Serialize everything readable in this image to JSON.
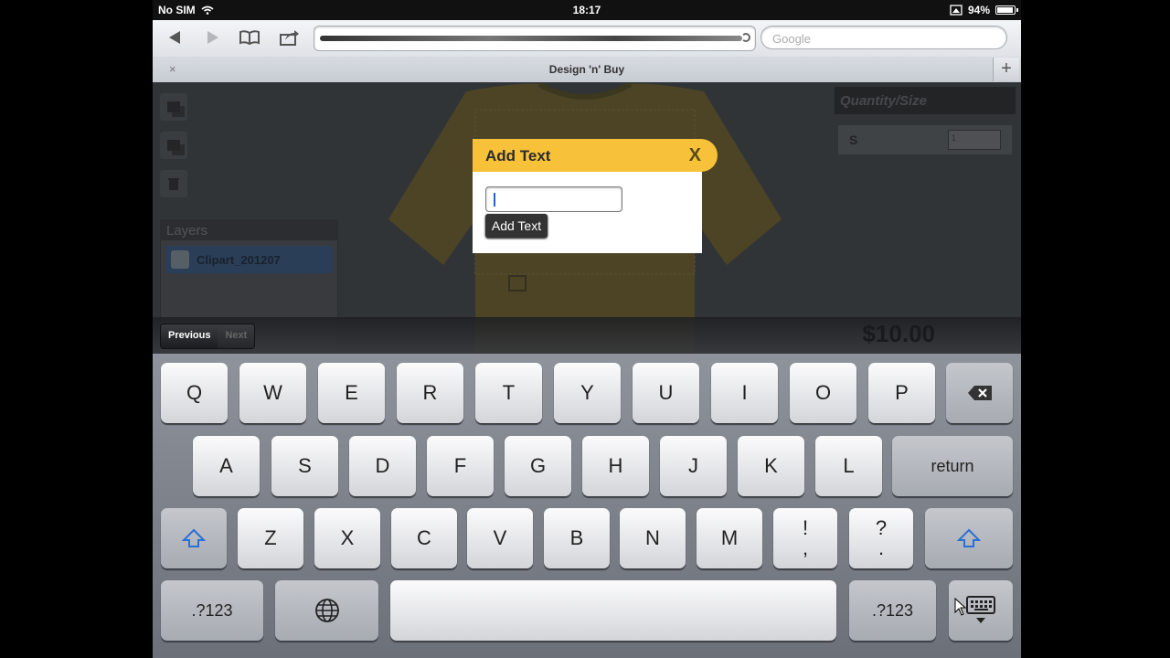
{
  "status": {
    "carrier": "No SIM",
    "time": "18:17",
    "battery": "94%"
  },
  "browser": {
    "search_placeholder": "Google",
    "tab_title": "Design 'n' Buy",
    "tab_close": "×",
    "new_tab": "+"
  },
  "page": {
    "layers_title": "Layers",
    "layer_item": "Clipart_201207",
    "qty_title": "Quantity/Size",
    "size_label": "S",
    "size_value": "1",
    "price": "$10.00"
  },
  "dialog": {
    "title": "Add Text",
    "close": "X",
    "button": "Add Text"
  },
  "form_nav": {
    "previous": "Previous",
    "next": "Next"
  },
  "keyboard": {
    "row1": [
      "Q",
      "W",
      "E",
      "R",
      "T",
      "Y",
      "U",
      "I",
      "O",
      "P"
    ],
    "row2": [
      "A",
      "S",
      "D",
      "F",
      "G",
      "H",
      "J",
      "K",
      "L"
    ],
    "row3": [
      "Z",
      "X",
      "C",
      "V",
      "B",
      "N",
      "M"
    ],
    "return": "return",
    "exclaim_top": "!",
    "exclaim_bottom": ",",
    "question_top": "?",
    "question_bottom": ".",
    "numbers": ".?123"
  },
  "colors": {
    "accent": "#f7c23a",
    "shift_blue": "#2a6fd6"
  },
  "icons": [
    "back-icon",
    "forward-icon",
    "bookmarks-icon",
    "share-icon",
    "reload-icon",
    "wifi-icon",
    "lock-icon",
    "battery-icon",
    "backspace-icon",
    "shift-icon",
    "globe-icon",
    "hide-keyboard-icon"
  ]
}
